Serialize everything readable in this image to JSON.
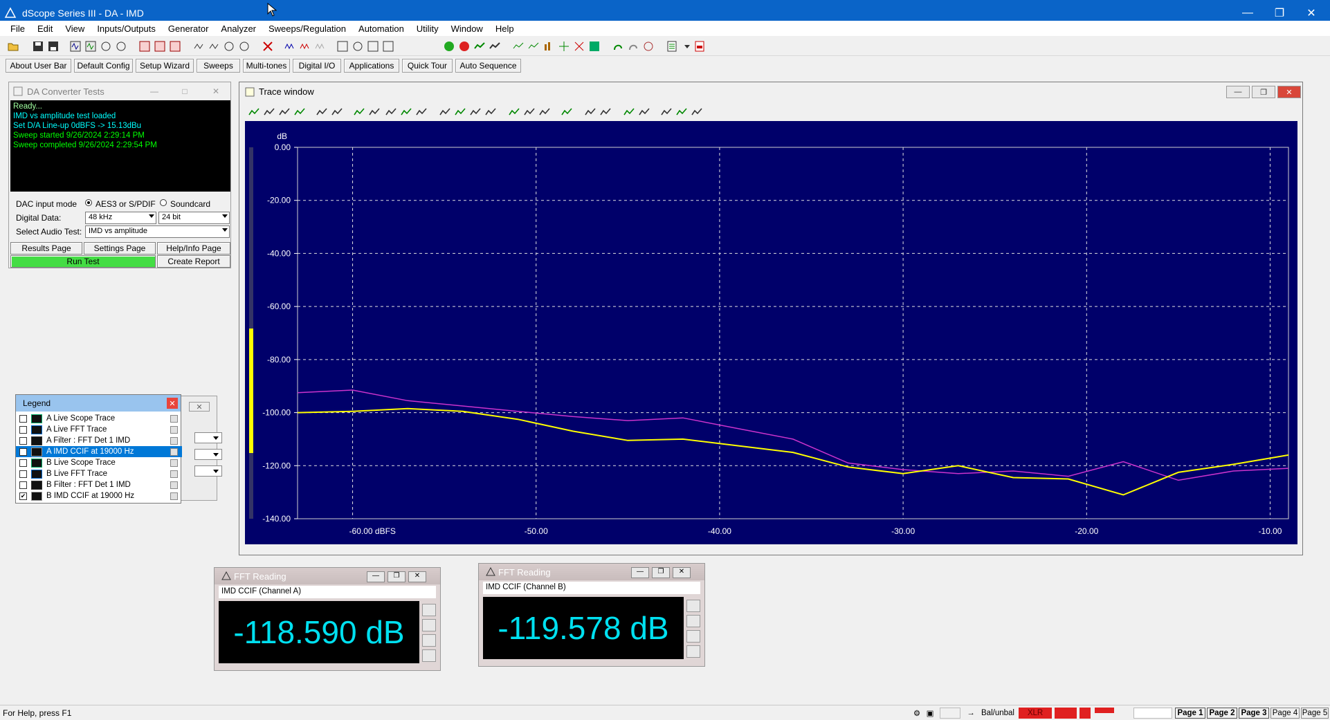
{
  "app": {
    "title": "dScope Series III - DA - IMD"
  },
  "colors": {
    "titlebar": "#0a64c8",
    "plot_bg": "#00006a",
    "series_a": "#ffff00",
    "series_b": "#cc33cc",
    "log_text": "#00ff00",
    "run_button": "#44dd44"
  },
  "menu": [
    "File",
    "Edit",
    "View",
    "Inputs/Outputs",
    "Generator",
    "Analyzer",
    "Sweeps/Regulation",
    "Automation",
    "Utility",
    "Window",
    "Help"
  ],
  "userbar": [
    "About User Bar",
    "Default Config",
    "Setup Wizard",
    "Sweeps",
    "Multi-tones",
    "Digital I/O",
    "Applications",
    "Quick Tour",
    "Auto Sequence"
  ],
  "da_panel": {
    "title": "DA Converter Tests",
    "log": [
      "Ready...",
      "IMD vs amplitude test loaded",
      "Set D/A Line-up 0dBFS -> 15.13dBu",
      "Sweep started 9/26/2024 2:29:14 PM",
      "Sweep completed 9/26/2024 2:29:54 PM"
    ],
    "dac_input_mode_label": "DAC input mode",
    "radio_aes": "AES3 or S/PDIF",
    "radio_soundcard": "Soundcard",
    "digital_data_label": "Digital Data:",
    "sample_rate": "48 kHz",
    "bit_depth": "24 bit",
    "select_test_label": "Select Audio Test:",
    "audio_test": "IMD vs amplitude",
    "results_btn": "Results Page",
    "settings_btn": "Settings Page",
    "help_btn": "Help/Info Page",
    "run_btn": "Run Test",
    "report_btn": "Create Report"
  },
  "trace_window": {
    "title": "Trace window",
    "ylabel": "dB"
  },
  "chart_data": {
    "type": "line",
    "ylabel": "dB",
    "xlim": [
      -63,
      -9
    ],
    "ylim": [
      -140,
      0
    ],
    "yticks": [
      0,
      -20,
      -40,
      -60,
      -80,
      -100,
      -120,
      -140
    ],
    "ytick_labels": [
      "0.00",
      "-20.00",
      "-40.00",
      "-60.00",
      "-80.00",
      "-100.00",
      "-120.00",
      "-140.00"
    ],
    "xticks": [
      -60,
      -50,
      -40,
      -30,
      -20,
      -10
    ],
    "xtick_labels": [
      "-60.00 dBFS",
      "-50.00",
      "-40.00",
      "-30.00",
      "-20.00",
      "-10.00"
    ],
    "grid": true,
    "series": [
      {
        "color": "#ffff00",
        "x": [
          -63,
          -60,
          -57,
          -54,
          -51,
          -48,
          -45,
          -42,
          -39,
          -36,
          -33,
          -30,
          -27,
          -24,
          -21,
          -18,
          -15,
          -12,
          -9
        ],
        "y": [
          -100,
          -99.5,
          -98.5,
          -99.5,
          -102.5,
          -107,
          -110.5,
          -110,
          -112.5,
          -115,
          -120.5,
          -123,
          -120,
          -124.5,
          -125,
          -131,
          -122.5,
          -119.5,
          -116
        ]
      },
      {
        "color": "#cc33cc",
        "x": [
          -63,
          -60,
          -57,
          -54,
          -51,
          -48,
          -45,
          -42,
          -39,
          -36,
          -33,
          -30,
          -27,
          -24,
          -21,
          -18,
          -15,
          -12,
          -9
        ],
        "y": [
          -92.5,
          -91.5,
          -95.5,
          -97.5,
          -99.5,
          -101.5,
          -103,
          -102,
          -106,
          -110,
          -119,
          -121.5,
          -123,
          -122,
          -124,
          -118.5,
          -125.5,
          -122,
          -121
        ]
      }
    ]
  },
  "legend": {
    "title": "Legend",
    "items": [
      {
        "label": "A  Live Scope Trace",
        "checked": false,
        "selected": false,
        "icon": "scope-icon"
      },
      {
        "label": "A  Live FFT Trace",
        "checked": false,
        "selected": false,
        "icon": "fft-icon"
      },
      {
        "label": "A  Filter : FFT Det 1 IMD",
        "checked": false,
        "selected": false,
        "icon": "filter-icon"
      },
      {
        "label": "A   IMD CCIF  at 19000 Hz",
        "checked": true,
        "selected": true,
        "icon": "line-icon"
      },
      {
        "label": "B  Live Scope Trace",
        "checked": false,
        "selected": false,
        "icon": "scope-icon"
      },
      {
        "label": "B  Live FFT Trace",
        "checked": false,
        "selected": false,
        "icon": "fft-icon"
      },
      {
        "label": "B  Filter : FFT Det 1 IMD",
        "checked": false,
        "selected": false,
        "icon": "filter-icon"
      },
      {
        "label": "B   IMD CCIF  at 19000 Hz",
        "checked": true,
        "selected": false,
        "icon": "line-icon"
      }
    ]
  },
  "fft_a": {
    "title": "FFT Reading",
    "subtitle": "IMD CCIF (Channel A)",
    "value": "-118.590 dB"
  },
  "fft_b": {
    "title": "FFT Reading",
    "subtitle": "IMD CCIF (Channel B)",
    "value": "-119.578 dB"
  },
  "status": {
    "help": "For Help, press F1",
    "balunbal": "Bal/unbal",
    "xlr": "XLR",
    "pages": [
      "Page 1",
      "Page 2",
      "Page 3",
      "Page 4",
      "Page 5"
    ]
  }
}
